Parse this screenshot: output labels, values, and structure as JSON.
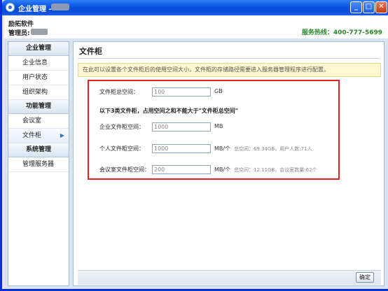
{
  "window": {
    "title": "企业管理 -",
    "controls": [
      "minimize",
      "maximize",
      "close"
    ]
  },
  "header": {
    "brand": "励拓软件",
    "admin_label": "管理员:",
    "hotline": "服务热线：400-777-5699"
  },
  "sidebar": {
    "sections": [
      {
        "title": "企业管理",
        "items": [
          "企业信息",
          "用户状态",
          "组织架构"
        ]
      },
      {
        "title": "功能管理",
        "items": [
          "会议室",
          "文件柜"
        ]
      },
      {
        "title": "系统管理",
        "items": [
          "管理服务器"
        ]
      }
    ],
    "active_item": "文件柜"
  },
  "main": {
    "title": "文件柜",
    "notice": "在此可以设置各个文件柜后的使用空间大小，文件柜的存储路径需要进入服务器管理程序进行配置。",
    "total": {
      "label": "文件柜总空间：",
      "value": "100",
      "unit": "GB"
    },
    "subhead": "以下3类文件柜，占用空间之和不能大于\"文件柜总空间\"",
    "enterprise": {
      "label": "企业文件柜空间：",
      "value": "1000",
      "unit": "MB"
    },
    "personal": {
      "label": "个人文件柜空间：",
      "value": "1000",
      "unit": "MB/个",
      "stat": "总空间：69.34GB，用户人数:71人"
    },
    "meeting": {
      "label": "会议室文件柜空间：",
      "value": "200",
      "unit": "MB/个",
      "stat": "总空间：12.11GB，会议室数量:62个"
    },
    "ok_label": "确定"
  },
  "colors": {
    "titlebar": "#0A53E0",
    "highlight_border": "#e02424",
    "hotline": "#2a8a2a"
  }
}
